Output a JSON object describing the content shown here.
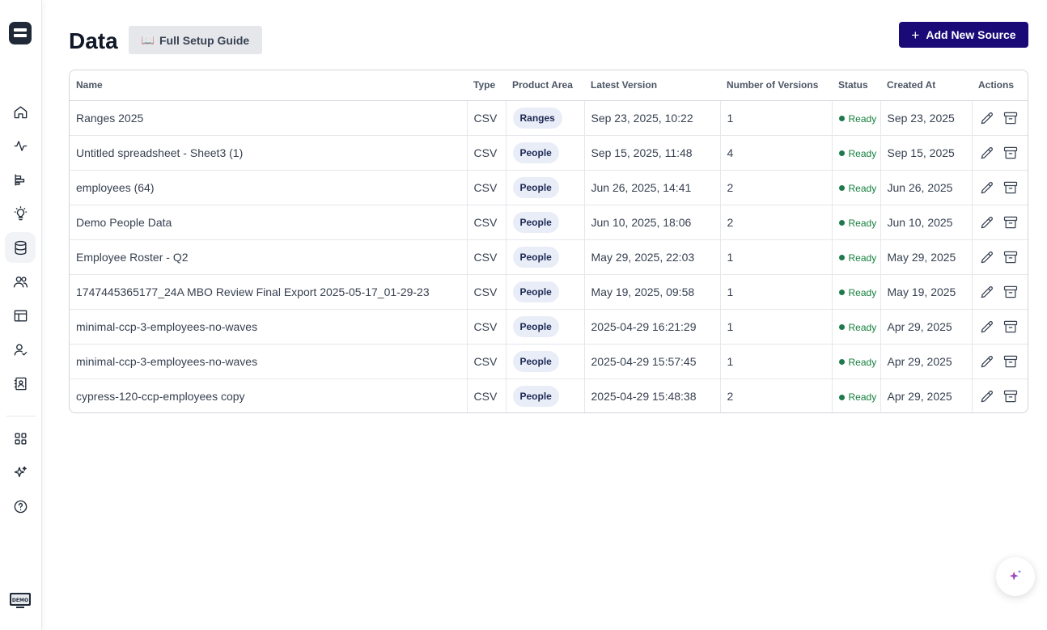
{
  "sidebar": {
    "items": [
      {
        "icon": "home-icon"
      },
      {
        "icon": "activity-icon"
      },
      {
        "icon": "bar-chart-icon"
      },
      {
        "icon": "lightbulb-icon"
      },
      {
        "icon": "database-icon",
        "active": true
      },
      {
        "icon": "users-icon"
      },
      {
        "icon": "layout-icon"
      },
      {
        "icon": "user-check-icon"
      },
      {
        "icon": "contact-book-icon"
      },
      {
        "icon": "grid-icon"
      },
      {
        "icon": "sparkles-icon"
      },
      {
        "icon": "help-icon"
      }
    ],
    "demo_label": "DEMO"
  },
  "header": {
    "title": "Data",
    "guide_icon": "📖",
    "guide_label": "Full Setup Guide",
    "add_label": "Add New Source"
  },
  "table": {
    "columns": [
      "Name",
      "Type",
      "Product Area",
      "Latest Version",
      "Number of Versions",
      "Status",
      "Created At",
      "Actions"
    ],
    "rows": [
      {
        "name": "Ranges 2025",
        "type": "CSV",
        "area": "Ranges",
        "latest": "Sep 23, 2025, 10:22",
        "versions": "1",
        "status": "Ready",
        "created": "Sep 23, 2025"
      },
      {
        "name": "Untitled spreadsheet - Sheet3 (1)",
        "type": "CSV",
        "area": "People",
        "latest": "Sep 15, 2025, 11:48",
        "versions": "4",
        "status": "Ready",
        "created": "Sep 15, 2025"
      },
      {
        "name": "employees (64)",
        "type": "CSV",
        "area": "People",
        "latest": "Jun 26, 2025, 14:41",
        "versions": "2",
        "status": "Ready",
        "created": "Jun 26, 2025"
      },
      {
        "name": "Demo People Data",
        "type": "CSV",
        "area": "People",
        "latest": "Jun 10, 2025, 18:06",
        "versions": "2",
        "status": "Ready",
        "created": "Jun 10, 2025"
      },
      {
        "name": "Employee Roster - Q2",
        "type": "CSV",
        "area": "People",
        "latest": "May 29, 2025, 22:03",
        "versions": "1",
        "status": "Ready",
        "created": "May 29, 2025"
      },
      {
        "name": "1747445365177_24A MBO Review Final Export 2025-05-17_01-29-23",
        "type": "CSV",
        "area": "People",
        "latest": "May 19, 2025, 09:58",
        "versions": "1",
        "status": "Ready",
        "created": "May 19, 2025"
      },
      {
        "name": "minimal-ccp-3-employees-no-waves",
        "type": "CSV",
        "area": "People",
        "latest": "2025-04-29 16:21:29",
        "versions": "1",
        "status": "Ready",
        "created": "Apr 29, 2025"
      },
      {
        "name": "minimal-ccp-3-employees-no-waves",
        "type": "CSV",
        "area": "People",
        "latest": "2025-04-29 15:57:45",
        "versions": "1",
        "status": "Ready",
        "created": "Apr 29, 2025"
      },
      {
        "name": "cypress-120-ccp-employees copy",
        "type": "CSV",
        "area": "People",
        "latest": "2025-04-29 15:48:38",
        "versions": "2",
        "status": "Ready",
        "created": "Apr 29, 2025"
      }
    ]
  },
  "colors": {
    "primary": "#1a0a78",
    "status_dot": "#1e7a4c",
    "pill_bg": "#e8edf7"
  }
}
